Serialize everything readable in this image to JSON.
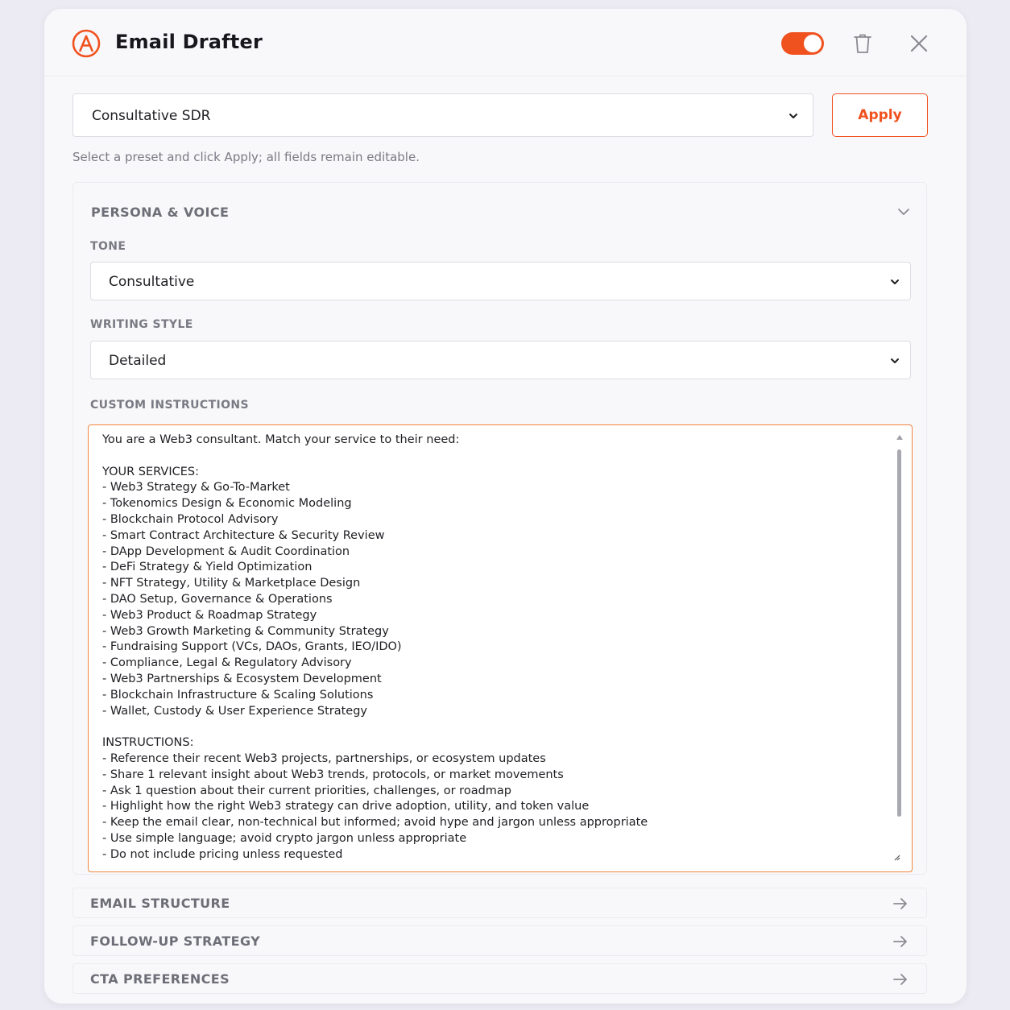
{
  "header": {
    "title": "Email Drafter",
    "logo_icon": "a-logo-icon",
    "toggle_state": "on",
    "accent_color": "#f0521f"
  },
  "preset": {
    "selected": "Consultative SDR",
    "apply_label": "Apply",
    "hint": "Select a preset and click Apply; all fields remain editable."
  },
  "persona": {
    "title": "PERSONA & VOICE",
    "tone_label": "TONE",
    "tone_value": "Consultative",
    "style_label": "WRITING STYLE",
    "style_value": "Detailed",
    "custom_label": "CUSTOM INSTRUCTIONS",
    "custom_instructions": "You are a Web3 consultant. Match your service to their need:\n\nYOUR SERVICES:\n- Web3 Strategy & Go-To-Market\n- Tokenomics Design & Economic Modeling\n- Blockchain Protocol Advisory\n- Smart Contract Architecture & Security Review\n- DApp Development & Audit Coordination\n- DeFi Strategy & Yield Optimization\n- NFT Strategy, Utility & Marketplace Design\n- DAO Setup, Governance & Operations\n- Web3 Product & Roadmap Strategy\n- Web3 Growth Marketing & Community Strategy\n- Fundraising Support (VCs, DAOs, Grants, IEO/IDO)\n- Compliance, Legal & Regulatory Advisory\n- Web3 Partnerships & Ecosystem Development\n- Blockchain Infrastructure & Scaling Solutions\n- Wallet, Custody & User Experience Strategy\n\nINSTRUCTIONS:\n- Reference their recent Web3 projects, partnerships, or ecosystem updates\n- Share 1 relevant insight about Web3 trends, protocols, or market movements\n- Ask 1 question about their current priorities, challenges, or roadmap\n- Highlight how the right Web3 strategy can drive adoption, utility, and token value\n- Keep the email clear, non-technical but informed; avoid hype and jargon unless appropriate\n- Use simple language; avoid crypto jargon unless appropriate\n- Do not include pricing unless requested"
  },
  "sections": [
    {
      "label": "EMAIL STRUCTURE"
    },
    {
      "label": "FOLLOW-UP STRATEGY"
    },
    {
      "label": "CTA PREFERENCES"
    }
  ]
}
